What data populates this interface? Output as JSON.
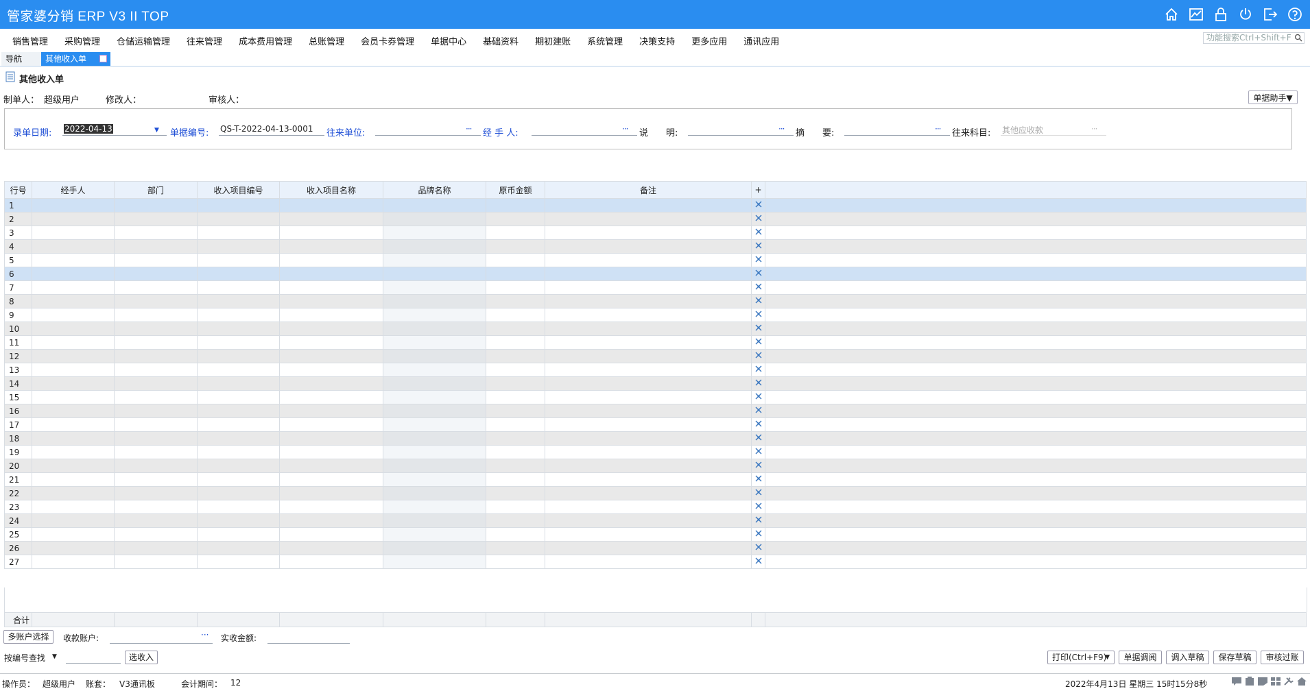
{
  "app": {
    "title": "管家婆分销 ERP V3 II TOP",
    "header_icons": [
      "home-icon",
      "chart-icon",
      "lock-icon",
      "power-icon",
      "exit-icon",
      "help-icon"
    ]
  },
  "menu": {
    "items": [
      "销售管理",
      "采购管理",
      "仓储运输管理",
      "往来管理",
      "成本费用管理",
      "总账管理",
      "会员卡券管理",
      "单据中心",
      "基础资料",
      "期初建账",
      "系统管理",
      "决策支持",
      "更多应用",
      "通讯应用"
    ],
    "search_placeholder": "功能搜索Ctrl+Shift+F"
  },
  "tabs": {
    "nav": "导航",
    "active": "其他收入单"
  },
  "page": {
    "title": "其他收入单"
  },
  "meta": {
    "creator_label": "制单人：",
    "creator": "超级用户",
    "modifier_label": "修改人：",
    "modifier": "",
    "auditor_label": "审核人：",
    "auditor": "",
    "helper_button": "单据助手▼"
  },
  "form": {
    "date_label": "录单日期:",
    "date_value": "2022-04-13",
    "no_label": "单据编号:",
    "no_value": "QS-T-2022-04-13-0001",
    "unit_label": "往来单位:",
    "unit_value": "",
    "handler_label": "经 手 人:",
    "handler_value": "",
    "desc_label": "说　　明:",
    "desc_value": "",
    "summary_label": "摘　　要:",
    "summary_value": "",
    "subject_label": "往来科目:",
    "subject_value": "其他应收款"
  },
  "grid": {
    "columns": [
      "行号",
      "经手人",
      "部门",
      "收入项目编号",
      "收入项目名称",
      "品牌名称",
      "原币金额",
      "备注",
      "+",
      ""
    ],
    "rows": [
      "1",
      "2",
      "3",
      "4",
      "5",
      "6",
      "7",
      "8",
      "9",
      "10",
      "11",
      "12",
      "13",
      "14",
      "15",
      "16",
      "17",
      "18",
      "19",
      "20",
      "21",
      "22",
      "23",
      "24",
      "25",
      "26",
      "27"
    ],
    "selected_rows": [
      1,
      6
    ],
    "total_label": "合计"
  },
  "bottom": {
    "multi_account_button": "多账户选择",
    "account_label": "收款账户:",
    "actual_label": "实收金额:",
    "search_mode": "按编号查找",
    "select_income_button": "选收入",
    "print_button": "打印(Ctrl+F9)",
    "adjust_button": "单据调阅",
    "load_draft_button": "调入草稿",
    "save_draft_button": "保存草稿",
    "audit_button": "审核过账"
  },
  "status": {
    "operator_label": "操作员：",
    "operator": "超级用户",
    "account_set_label": "账套：",
    "account_set": "V3通讯板",
    "period_label": "会计期间：",
    "period": "12",
    "datetime": "2022年4月13日  星期三  15时15分8秒"
  },
  "colors": {
    "accent": "#2a8df0",
    "label_blue": "#1f4fd6"
  }
}
